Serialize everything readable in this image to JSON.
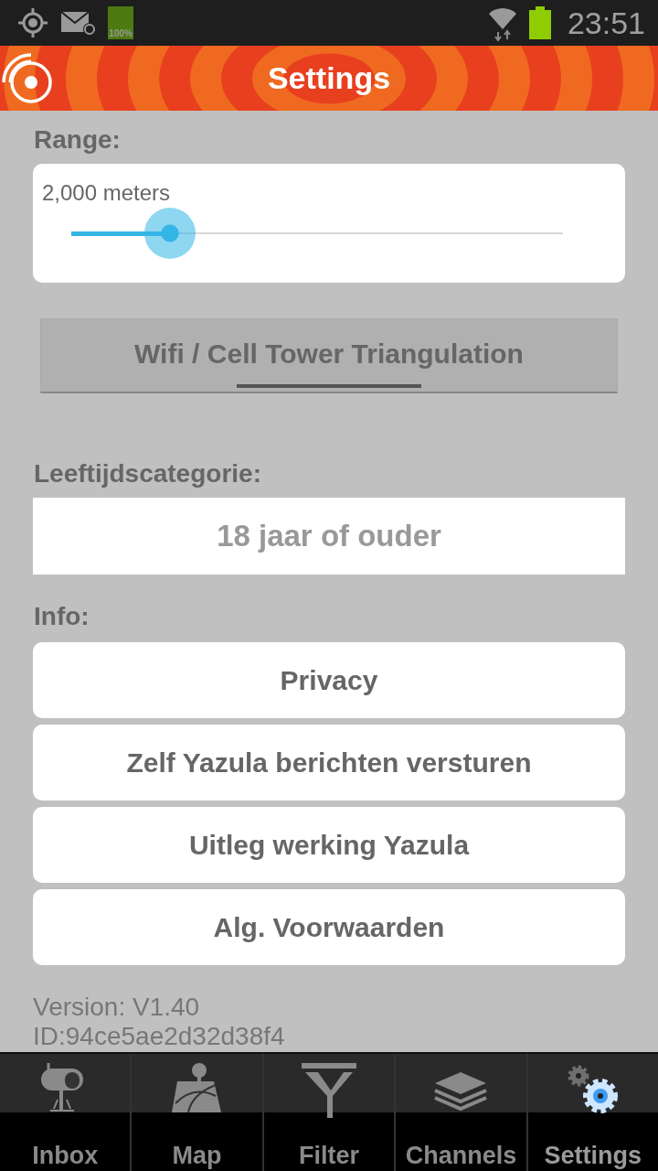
{
  "status_bar": {
    "battery_label": "100%",
    "time": "23:51"
  },
  "header": {
    "title": "Settings"
  },
  "range": {
    "label": "Range:",
    "reading": "2,000 meters",
    "level": 0.2
  },
  "location_toggle": {
    "label": "Wifi / Cell Tower Triangulation",
    "on": false
  },
  "age": {
    "label": "Leeftijdscategorie:",
    "value": "18 jaar of ouder"
  },
  "info": {
    "label": "Info:",
    "buttons": [
      "Privacy",
      "Zelf Yazula berichten versturen",
      "Uitleg werking Yazula",
      "Alg. Voorwaarden"
    ]
  },
  "version": "Version: V1.40",
  "device_id": "ID:94ce5ae2d32d38f4",
  "nav": [
    {
      "label": "Inbox",
      "selected": false
    },
    {
      "label": "Map",
      "selected": false
    },
    {
      "label": "Filter",
      "selected": false
    },
    {
      "label": "Channels",
      "selected": false
    },
    {
      "label": "Settings",
      "selected": true
    }
  ]
}
